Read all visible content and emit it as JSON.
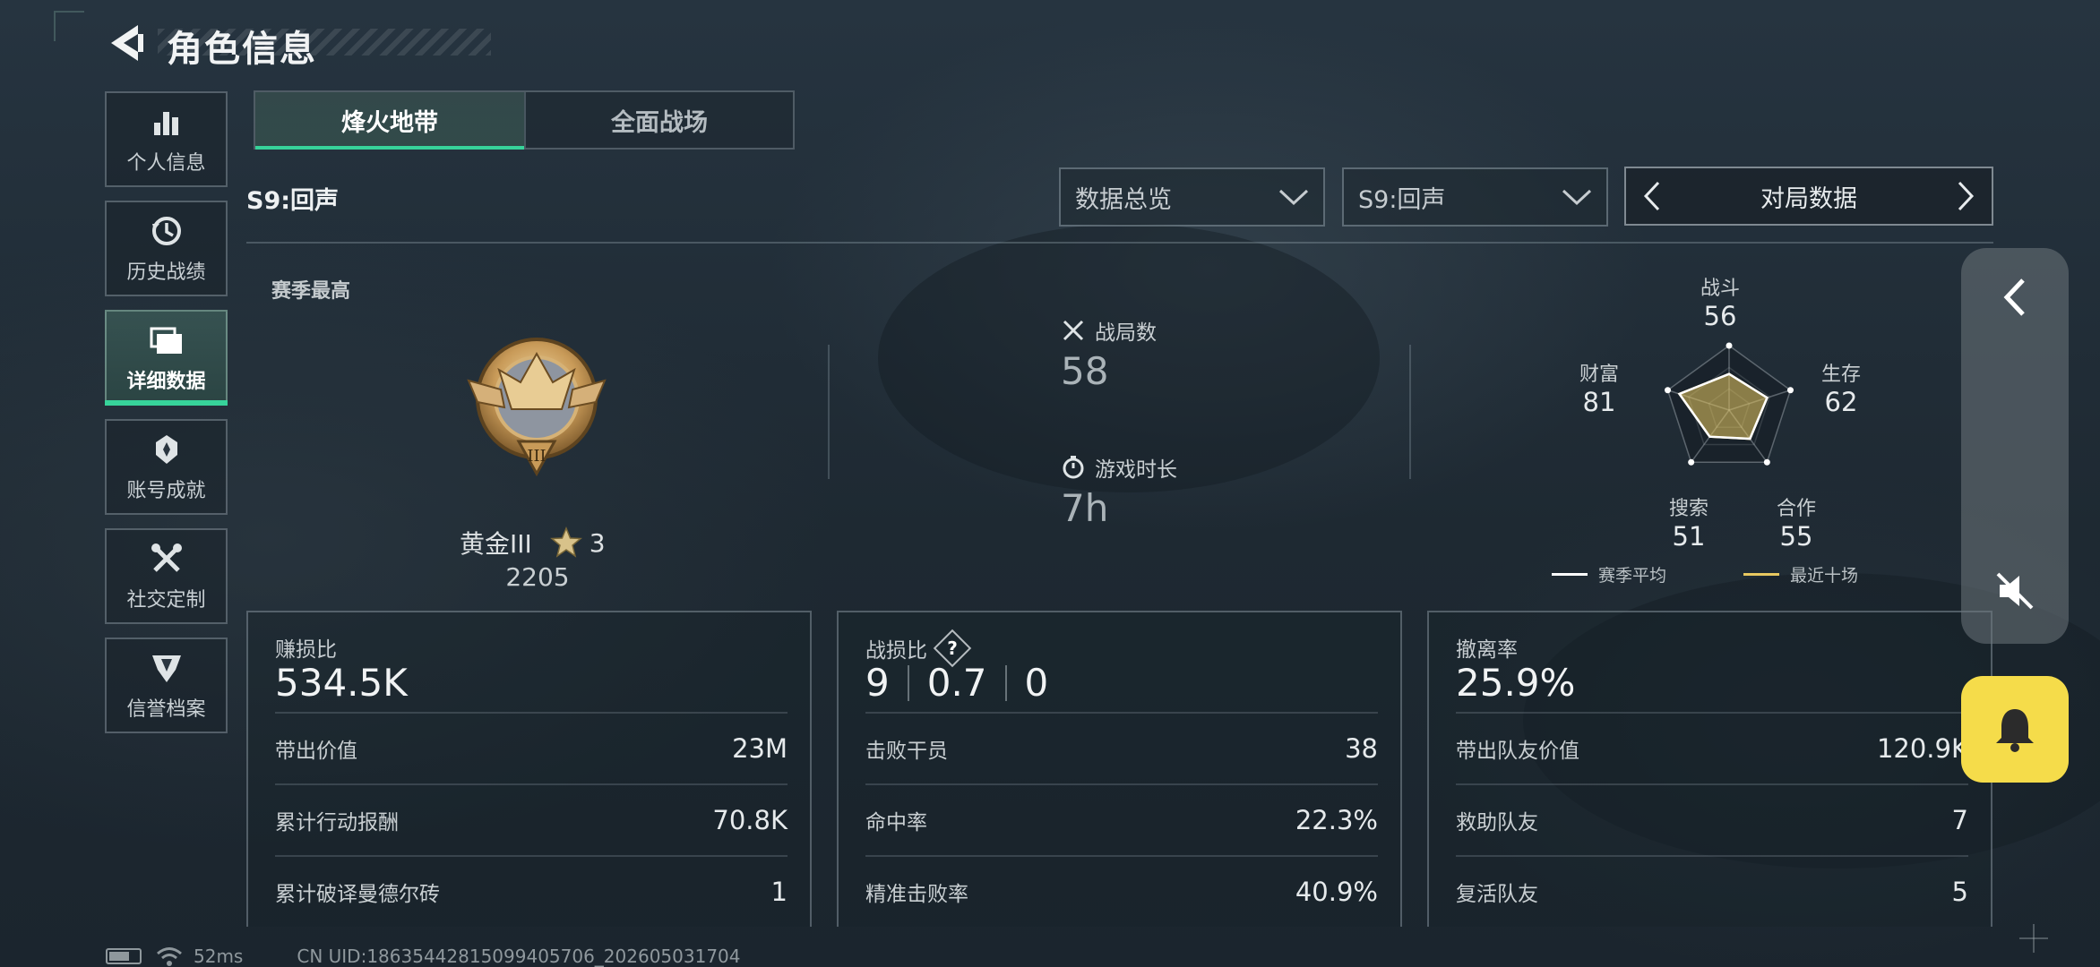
{
  "header": {
    "title": "角色信息"
  },
  "sidebar": {
    "items": [
      {
        "label": "个人信息",
        "icon": "bar-chart-icon"
      },
      {
        "label": "历史战绩",
        "icon": "history-clock-icon"
      },
      {
        "label": "详细数据",
        "icon": "folder-icon",
        "active": true
      },
      {
        "label": "账号成就",
        "icon": "achievement-badge-icon"
      },
      {
        "label": "社交定制",
        "icon": "tools-icon"
      },
      {
        "label": "信誉档案",
        "icon": "credit-shield-icon"
      }
    ]
  },
  "tabs": [
    {
      "label": "烽火地带",
      "active": true
    },
    {
      "label": "全面战场",
      "active": false
    }
  ],
  "filters": {
    "season_label": "S9:回声",
    "dropdown_overview": "数据总览",
    "dropdown_season": "S9:回声",
    "pager_label": "对局数据"
  },
  "overview": {
    "season_best_label": "赛季最高",
    "rank_name": "黄金III",
    "rank_stars": "3",
    "rank_score": "2205",
    "matches_label": "战局数",
    "matches_value": "58",
    "playtime_label": "游戏时长",
    "playtime_value": "7h"
  },
  "radar": {
    "axes": [
      {
        "name": "战斗",
        "value": "56"
      },
      {
        "name": "生存",
        "value": "62"
      },
      {
        "name": "合作",
        "value": "55"
      },
      {
        "name": "搜索",
        "value": "51"
      },
      {
        "name": "财富",
        "value": "81"
      }
    ],
    "legend_season_avg": "赛季平均",
    "legend_recent_ten": "最近十场",
    "season_avg_color": "#ffffff",
    "recent_ten_color": "#e8c860",
    "season_avg_values": [
      56,
      62,
      55,
      51,
      81
    ],
    "recent_ten_values": [
      56,
      62,
      55,
      51,
      81
    ]
  },
  "cards": {
    "profit": {
      "title": "赚损比",
      "big": "534.5K",
      "rows": [
        {
          "k": "带出价值",
          "v": "23M"
        },
        {
          "k": "累计行动报酬",
          "v": "70.8K"
        },
        {
          "k": "累计破译曼德尔砖",
          "v": "1"
        }
      ]
    },
    "combat": {
      "title": "战损比",
      "big_parts": [
        "9",
        "0.7",
        "0"
      ],
      "rows": [
        {
          "k": "击败干员",
          "v": "38"
        },
        {
          "k": "命中率",
          "v": "22.3%"
        },
        {
          "k": "精准击败率",
          "v": "40.9%"
        }
      ]
    },
    "extract": {
      "title": "撤离率",
      "big": "25.9%",
      "rows": [
        {
          "k": "带出队友价值",
          "v": "120.9K"
        },
        {
          "k": "救助队友",
          "v": "7"
        },
        {
          "k": "复活队友",
          "v": "5"
        }
      ]
    }
  },
  "footer": {
    "ping": "52ms",
    "uid": "CN UID:1863544281509940570​6_202605031704"
  },
  "colors": {
    "accent": "#37d39a",
    "bell": "#f5dc4a"
  }
}
